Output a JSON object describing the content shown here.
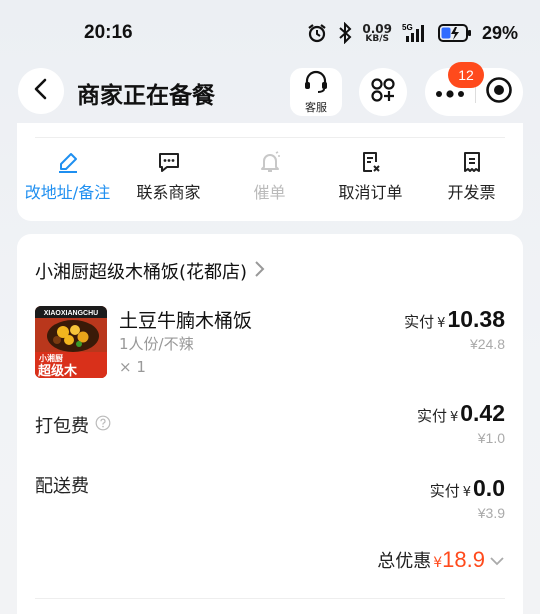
{
  "status_bar": {
    "time": "20:16",
    "net_speed_value": "0.09",
    "net_speed_unit": "KB/S",
    "network": "5G",
    "battery": "29%"
  },
  "header": {
    "title": "商家正在备餐",
    "service_label": "客服",
    "badge_count": "12"
  },
  "actions": [
    {
      "label": "改地址/备注",
      "icon": "edit-icon",
      "state": "active"
    },
    {
      "label": "联系商家",
      "icon": "chat-icon",
      "state": "normal"
    },
    {
      "label": "催单",
      "icon": "bell-icon",
      "state": "disabled"
    },
    {
      "label": "取消订单",
      "icon": "cancel-order-icon",
      "state": "normal"
    },
    {
      "label": "开发票",
      "icon": "invoice-icon",
      "state": "normal"
    }
  ],
  "order": {
    "shop_name": "小湘厨超级木桶饭(花都店)",
    "item": {
      "name": "土豆牛腩木桶饭",
      "spec": "1人份/不辣",
      "qty": "× 1",
      "paid_label": "实付",
      "currency": "¥",
      "paid": "10.38",
      "original": "¥24.8",
      "thumb_text_top": "小湘厨",
      "thumb_text_main": "超级木",
      "thumb_text_banner": "XIAOXIANGCHU"
    },
    "packing_fee": {
      "label": "打包费",
      "paid_label": "实付",
      "currency": "¥",
      "paid": "0.42",
      "original": "¥1.0"
    },
    "delivery_fee": {
      "label": "配送费",
      "paid_label": "实付",
      "currency": "¥",
      "paid": "0.0",
      "original": "¥3.9"
    },
    "total_discount": {
      "label": "总优惠",
      "currency": "¥",
      "value": "18.9"
    }
  },
  "colors": {
    "accent_blue": "#1f8ff0",
    "discount_red": "#ff4a1c",
    "badge_red": "#ff4a1c"
  }
}
